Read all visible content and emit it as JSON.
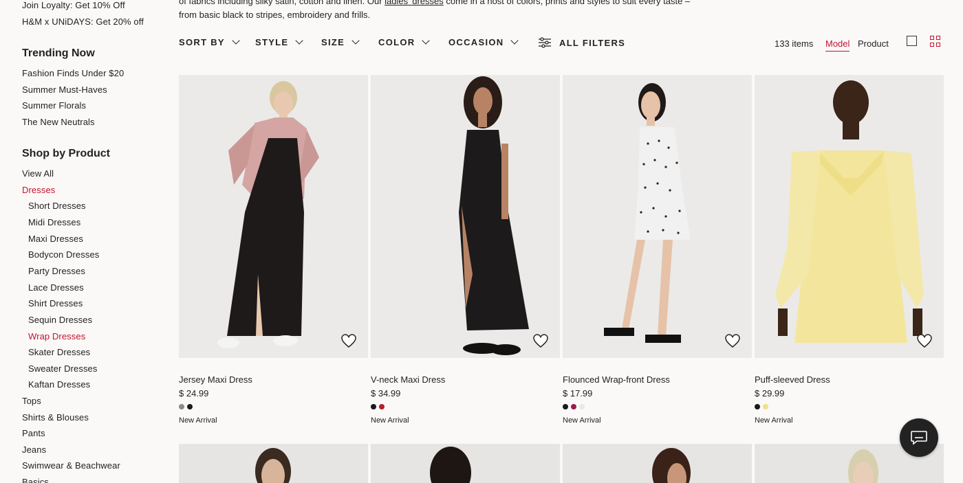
{
  "sidebar": {
    "promos": [
      "Join Loyalty: Get 10% Off",
      "H&M x UNiDAYS: Get 20% off"
    ],
    "trending_heading": "Trending Now",
    "trending": [
      "Fashion Finds Under $20",
      "Summer Must-Haves",
      "Summer Florals",
      "The New Neutrals"
    ],
    "shop_heading": "Shop by Product",
    "view_all": "View All",
    "dresses": "Dresses",
    "dress_types": [
      "Short Dresses",
      "Midi Dresses",
      "Maxi Dresses",
      "Bodycon Dresses",
      "Party Dresses",
      "Lace Dresses",
      "Shirt Dresses",
      "Sequin Dresses",
      "Wrap Dresses",
      "Skater Dresses",
      "Sweater Dresses",
      "Kaftan Dresses"
    ],
    "categories": [
      "Tops",
      "Shirts & Blouses",
      "Pants",
      "Jeans",
      "Swimwear & Beachwear",
      "Basics"
    ]
  },
  "intro": {
    "line1_before": "of fabrics including silky satin, cotton and linen. Our ",
    "line1_link": "ladies' dresses",
    "line1_after": " come in a host of colors, prints and styles to suit every taste –",
    "line2": "from basic black to stripes, embroidery and frills."
  },
  "filters": {
    "sort_by": "SORT BY",
    "style": "STYLE",
    "size": "SIZE",
    "color": "COLOR",
    "occasion": "OCCASION",
    "all_filters": "ALL FILTERS"
  },
  "toolbar": {
    "items_count": "133 items",
    "model_tab": "Model",
    "product_tab": "Product"
  },
  "products": [
    {
      "name": "Jersey Maxi Dress",
      "price": "$ 24.99",
      "badge": "New Arrival",
      "swatches": [
        "#8a8a8a",
        "#1a1a1a"
      ]
    },
    {
      "name": "V-neck Maxi Dress",
      "price": "$ 34.99",
      "badge": "New Arrival",
      "swatches": [
        "#1a1a1a",
        "#b3202a"
      ]
    },
    {
      "name": "Flounced Wrap-front Dress",
      "price": "$ 17.99",
      "badge": "New Arrival",
      "swatches": [
        "#1a1a1a",
        "#9b1b4e",
        "#e8e8e8"
      ]
    },
    {
      "name": "Puff-sleeved Dress",
      "price": "$ 29.99",
      "badge": "New Arrival",
      "swatches": [
        "#1a1a1a",
        "#f2df86"
      ]
    }
  ],
  "colors": {
    "accent": "#c8102e",
    "text": "#222222",
    "background": "#faf9f8"
  }
}
